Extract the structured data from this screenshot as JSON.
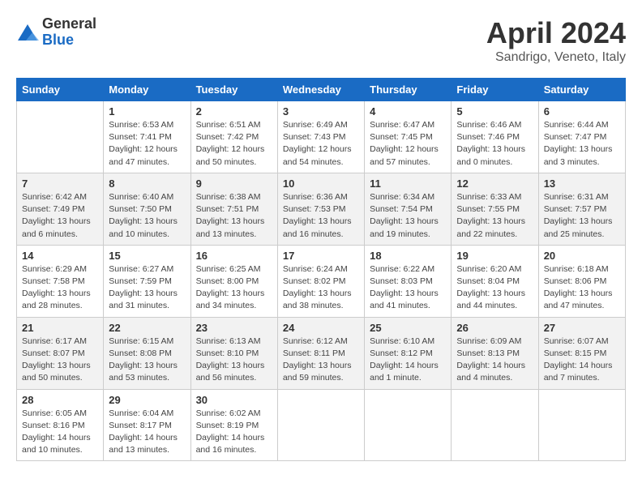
{
  "logo": {
    "general": "General",
    "blue": "Blue"
  },
  "title": "April 2024",
  "subtitle": "Sandrigo, Veneto, Italy",
  "days_of_week": [
    "Sunday",
    "Monday",
    "Tuesday",
    "Wednesday",
    "Thursday",
    "Friday",
    "Saturday"
  ],
  "weeks": [
    [
      {
        "day": "",
        "info": ""
      },
      {
        "day": "1",
        "info": "Sunrise: 6:53 AM\nSunset: 7:41 PM\nDaylight: 12 hours\nand 47 minutes."
      },
      {
        "day": "2",
        "info": "Sunrise: 6:51 AM\nSunset: 7:42 PM\nDaylight: 12 hours\nand 50 minutes."
      },
      {
        "day": "3",
        "info": "Sunrise: 6:49 AM\nSunset: 7:43 PM\nDaylight: 12 hours\nand 54 minutes."
      },
      {
        "day": "4",
        "info": "Sunrise: 6:47 AM\nSunset: 7:45 PM\nDaylight: 12 hours\nand 57 minutes."
      },
      {
        "day": "5",
        "info": "Sunrise: 6:46 AM\nSunset: 7:46 PM\nDaylight: 13 hours\nand 0 minutes."
      },
      {
        "day": "6",
        "info": "Sunrise: 6:44 AM\nSunset: 7:47 PM\nDaylight: 13 hours\nand 3 minutes."
      }
    ],
    [
      {
        "day": "7",
        "info": "Sunrise: 6:42 AM\nSunset: 7:49 PM\nDaylight: 13 hours\nand 6 minutes."
      },
      {
        "day": "8",
        "info": "Sunrise: 6:40 AM\nSunset: 7:50 PM\nDaylight: 13 hours\nand 10 minutes."
      },
      {
        "day": "9",
        "info": "Sunrise: 6:38 AM\nSunset: 7:51 PM\nDaylight: 13 hours\nand 13 minutes."
      },
      {
        "day": "10",
        "info": "Sunrise: 6:36 AM\nSunset: 7:53 PM\nDaylight: 13 hours\nand 16 minutes."
      },
      {
        "day": "11",
        "info": "Sunrise: 6:34 AM\nSunset: 7:54 PM\nDaylight: 13 hours\nand 19 minutes."
      },
      {
        "day": "12",
        "info": "Sunrise: 6:33 AM\nSunset: 7:55 PM\nDaylight: 13 hours\nand 22 minutes."
      },
      {
        "day": "13",
        "info": "Sunrise: 6:31 AM\nSunset: 7:57 PM\nDaylight: 13 hours\nand 25 minutes."
      }
    ],
    [
      {
        "day": "14",
        "info": "Sunrise: 6:29 AM\nSunset: 7:58 PM\nDaylight: 13 hours\nand 28 minutes."
      },
      {
        "day": "15",
        "info": "Sunrise: 6:27 AM\nSunset: 7:59 PM\nDaylight: 13 hours\nand 31 minutes."
      },
      {
        "day": "16",
        "info": "Sunrise: 6:25 AM\nSunset: 8:00 PM\nDaylight: 13 hours\nand 34 minutes."
      },
      {
        "day": "17",
        "info": "Sunrise: 6:24 AM\nSunset: 8:02 PM\nDaylight: 13 hours\nand 38 minutes."
      },
      {
        "day": "18",
        "info": "Sunrise: 6:22 AM\nSunset: 8:03 PM\nDaylight: 13 hours\nand 41 minutes."
      },
      {
        "day": "19",
        "info": "Sunrise: 6:20 AM\nSunset: 8:04 PM\nDaylight: 13 hours\nand 44 minutes."
      },
      {
        "day": "20",
        "info": "Sunrise: 6:18 AM\nSunset: 8:06 PM\nDaylight: 13 hours\nand 47 minutes."
      }
    ],
    [
      {
        "day": "21",
        "info": "Sunrise: 6:17 AM\nSunset: 8:07 PM\nDaylight: 13 hours\nand 50 minutes."
      },
      {
        "day": "22",
        "info": "Sunrise: 6:15 AM\nSunset: 8:08 PM\nDaylight: 13 hours\nand 53 minutes."
      },
      {
        "day": "23",
        "info": "Sunrise: 6:13 AM\nSunset: 8:10 PM\nDaylight: 13 hours\nand 56 minutes."
      },
      {
        "day": "24",
        "info": "Sunrise: 6:12 AM\nSunset: 8:11 PM\nDaylight: 13 hours\nand 59 minutes."
      },
      {
        "day": "25",
        "info": "Sunrise: 6:10 AM\nSunset: 8:12 PM\nDaylight: 14 hours\nand 1 minute."
      },
      {
        "day": "26",
        "info": "Sunrise: 6:09 AM\nSunset: 8:13 PM\nDaylight: 14 hours\nand 4 minutes."
      },
      {
        "day": "27",
        "info": "Sunrise: 6:07 AM\nSunset: 8:15 PM\nDaylight: 14 hours\nand 7 minutes."
      }
    ],
    [
      {
        "day": "28",
        "info": "Sunrise: 6:05 AM\nSunset: 8:16 PM\nDaylight: 14 hours\nand 10 minutes."
      },
      {
        "day": "29",
        "info": "Sunrise: 6:04 AM\nSunset: 8:17 PM\nDaylight: 14 hours\nand 13 minutes."
      },
      {
        "day": "30",
        "info": "Sunrise: 6:02 AM\nSunset: 8:19 PM\nDaylight: 14 hours\nand 16 minutes."
      },
      {
        "day": "",
        "info": ""
      },
      {
        "day": "",
        "info": ""
      },
      {
        "day": "",
        "info": ""
      },
      {
        "day": "",
        "info": ""
      }
    ]
  ]
}
